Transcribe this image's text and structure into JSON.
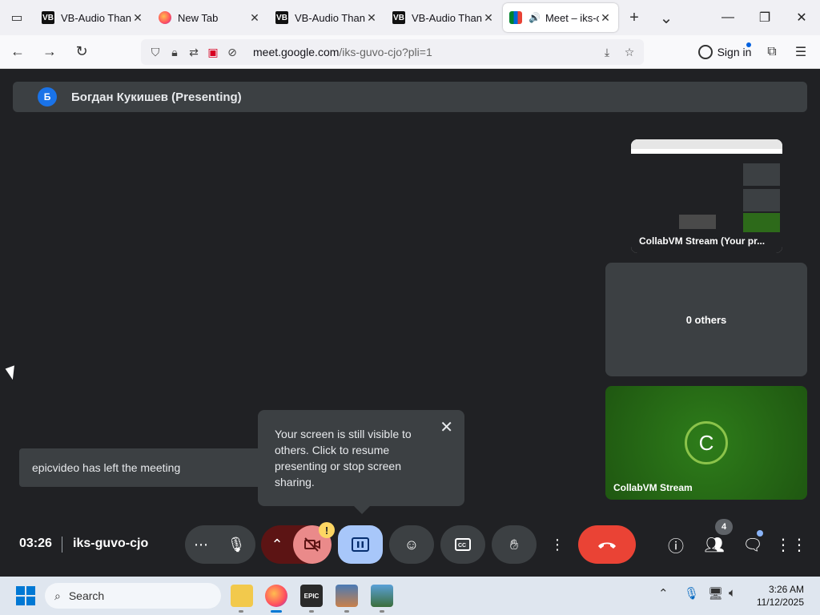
{
  "browser": {
    "tabs": [
      {
        "title": "VB-Audio Thank",
        "favicon": "vb",
        "active": false
      },
      {
        "title": "New Tab",
        "favicon": "firefox",
        "active": false
      },
      {
        "title": "VB-Audio Thank",
        "favicon": "vb",
        "active": false
      },
      {
        "title": "VB-Audio Thank",
        "favicon": "vb",
        "active": false
      },
      {
        "title": "Meet – iks-c",
        "favicon": "meet",
        "active": true,
        "audio": true
      }
    ],
    "url_domain": "meet.google.com",
    "url_path": "/iks-guvo-cjo?pli=1",
    "signin_label": "Sign in"
  },
  "meet": {
    "presenter_initial": "Б",
    "presenter_label": "Богдан Кукишев (Presenting)",
    "self_tile_label": "CollabVM Stream (Your pr...",
    "others_label": "0 others",
    "participant_initial": "C",
    "participant_label": "CollabVM Stream",
    "toast_text": "epicvideo has left the meeting",
    "popup_text": "Your screen is still visible to others. Click to resume presenting or stop screen sharing.",
    "time": "03:26",
    "meeting_code": "iks-guvo-cjo",
    "people_count": "4",
    "warning_glyph": "!"
  },
  "taskbar": {
    "search_placeholder": "Search",
    "time": "3:26 AM",
    "date": "11/12/2025"
  },
  "colors": {
    "meet_bg": "#202124",
    "tile_bg": "#3c4043",
    "end_call": "#ea4335",
    "present_active": "#a8c7fa",
    "participant_tile": "#2e7d1a"
  }
}
